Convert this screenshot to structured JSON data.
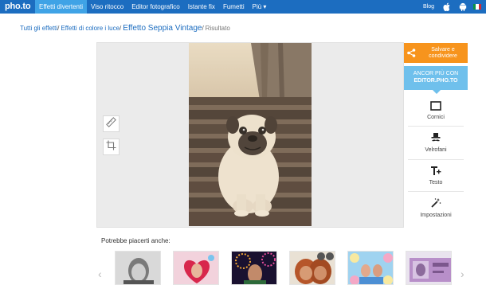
{
  "header": {
    "logo": "pho.to",
    "nav": [
      {
        "label": "Effetti divertenti",
        "active": true
      },
      {
        "label": "Viso ritocco"
      },
      {
        "label": "Editor fotografico"
      },
      {
        "label": "Istante fix"
      },
      {
        "label": "Fumetti"
      },
      {
        "label": "Più ▾"
      }
    ],
    "blog": "Blog",
    "icons": [
      "apple-icon",
      "android-icon",
      "italy-flag-icon"
    ]
  },
  "breadcrumb": {
    "all_effects": "Tutti gli effetti",
    "category": "Effetti di colore i luce",
    "current": "Effetto Seppia Vintage",
    "result": "Risultato"
  },
  "tools": [
    "ruler-icon",
    "crop-icon"
  ],
  "sidebar": {
    "save_label_1": "Salvare e",
    "save_label_2": "condividere",
    "editor_line1": "ANCOR PIÙ CON",
    "editor_line2": "EDITOR.PHO.TO",
    "items": [
      {
        "label": "Cornici",
        "icon": "frame-icon"
      },
      {
        "label": "Velrofani",
        "icon": "hat-mustache-icon"
      },
      {
        "label": "Testo",
        "icon": "text-plus-icon"
      },
      {
        "label": "Impostazioni",
        "icon": "magic-wand-icon"
      }
    ]
  },
  "suggestions": {
    "title": "Potrebbe piacerti anche:",
    "prev": "‹",
    "next": "›",
    "thumbs": [
      "bw-portrait",
      "heart-frame",
      "fireworks",
      "orangutan",
      "flower-frame",
      "banknote"
    ]
  },
  "colors": {
    "topbar": "#1c6dc0",
    "active_tab": "#3fa3e6",
    "save": "#f7941d",
    "editor": "#6fc0ec"
  }
}
